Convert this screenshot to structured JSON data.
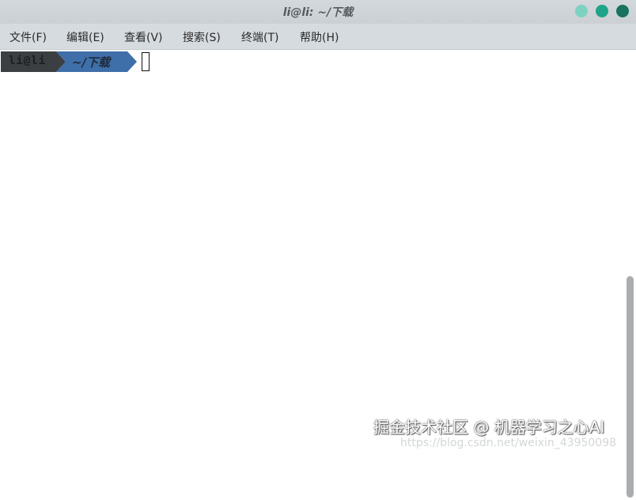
{
  "window": {
    "title": "li@li: ~/下载",
    "controls": {
      "minimize_color": "#7fd1c1",
      "maximize_color": "#1fa48a",
      "close_color": "#17725f"
    }
  },
  "menubar": {
    "items": [
      {
        "label": "文件(F)"
      },
      {
        "label": "编辑(E)"
      },
      {
        "label": "查看(V)"
      },
      {
        "label": "搜索(S)"
      },
      {
        "label": "终端(T)"
      },
      {
        "label": "帮助(H)"
      }
    ]
  },
  "terminal": {
    "prompt": {
      "user": "li@li",
      "directory": "~/下载",
      "user_segment_color": "#3b3f42",
      "dir_segment_color": "#3f6fa8"
    }
  },
  "watermark": {
    "text": "掘金技术社区 @ 机器学习之心AI",
    "subtext": "https://blog.csdn.net/weixin_43950098"
  }
}
